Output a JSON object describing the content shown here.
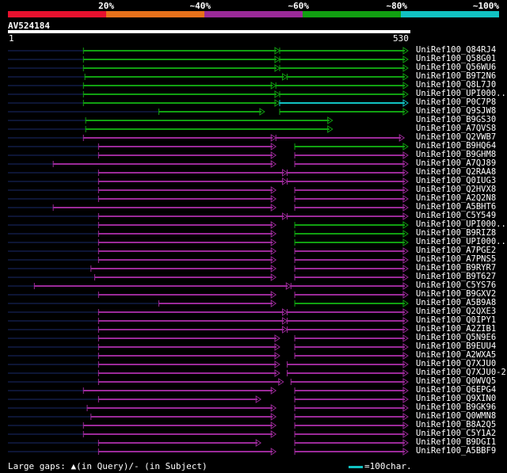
{
  "legend": {
    "labels": [
      "20%",
      "~40%",
      "~60%",
      "~80%",
      "~100%"
    ],
    "colors": [
      "#e8112e",
      "#e8711b",
      "#9b2a99",
      "#11a011",
      "#11c3c3"
    ]
  },
  "query": {
    "name": "AV524184",
    "start_label": "1",
    "end_label": "530"
  },
  "footer": {
    "gaps_text": "Large gaps: ▲(in Query)/- (in Subject)",
    "scale_text": "=100char."
  },
  "chart_data": {
    "type": "alignment",
    "query_length": 530,
    "hits": [
      {
        "name": "UniRef100_Q84RJ4",
        "segments": [
          [
            100,
            360,
            "green"
          ],
          [
            360,
            530,
            "green"
          ]
        ]
      },
      {
        "name": "UniRef100_Q58G01",
        "segments": [
          [
            100,
            360,
            "green"
          ],
          [
            360,
            530,
            "green"
          ]
        ]
      },
      {
        "name": "UniRef100_Q56WU6",
        "segments": [
          [
            100,
            360,
            "green"
          ],
          [
            360,
            530,
            "green"
          ]
        ]
      },
      {
        "name": "UniRef100_B9T2N6",
        "segments": [
          [
            102,
            370,
            "green"
          ],
          [
            370,
            530,
            "green"
          ]
        ]
      },
      {
        "name": "UniRef100_Q8L7J0",
        "segments": [
          [
            100,
            355,
            "green"
          ],
          [
            355,
            530,
            "green"
          ]
        ]
      },
      {
        "name": "UniRef100_UPI000..",
        "segments": [
          [
            100,
            360,
            "green"
          ],
          [
            360,
            530,
            "green"
          ]
        ]
      },
      {
        "name": "UniRef100_P0C7P8",
        "segments": [
          [
            100,
            360,
            "green"
          ],
          [
            360,
            530,
            "cyan"
          ]
        ]
      },
      {
        "name": "UniRef100_Q9SJW8",
        "segments": [
          [
            200,
            340,
            "green"
          ],
          [
            360,
            530,
            "green"
          ]
        ]
      },
      {
        "name": "UniRef100_B9GS30",
        "segments": [
          [
            103,
            430,
            "green"
          ]
        ]
      },
      {
        "name": "UniRef100_A7QVS8",
        "segments": [
          [
            103,
            430,
            "green"
          ]
        ]
      },
      {
        "name": "UniRef100_Q2VWB7",
        "segments": [
          [
            100,
            355,
            "purple"
          ],
          [
            355,
            525,
            "purple"
          ]
        ]
      },
      {
        "name": "UniRef100_B9HQ64",
        "segments": [
          [
            120,
            355,
            "purple"
          ],
          [
            380,
            530,
            "green"
          ]
        ]
      },
      {
        "name": "UniRef100_B9GHM8",
        "segments": [
          [
            120,
            355,
            "purple"
          ],
          [
            380,
            530,
            "purple"
          ]
        ]
      },
      {
        "name": "UniRef100_A7QJ89",
        "segments": [
          [
            60,
            355,
            "purple"
          ],
          [
            380,
            530,
            "purple"
          ]
        ]
      },
      {
        "name": "UniRef100_Q2RAA8",
        "segments": [
          [
            120,
            370,
            "purple"
          ],
          [
            370,
            530,
            "purple"
          ]
        ]
      },
      {
        "name": "UniRef100_Q0IUG3",
        "segments": [
          [
            120,
            370,
            "purple"
          ],
          [
            370,
            530,
            "purple"
          ]
        ]
      },
      {
        "name": "UniRef100_Q2HVX8",
        "segments": [
          [
            120,
            355,
            "purple"
          ],
          [
            380,
            530,
            "purple"
          ]
        ]
      },
      {
        "name": "UniRef100_A2Q2N8",
        "segments": [
          [
            120,
            355,
            "purple"
          ],
          [
            380,
            530,
            "purple"
          ]
        ]
      },
      {
        "name": "UniRef100_A5BHT6",
        "segments": [
          [
            60,
            355,
            "purple"
          ],
          [
            380,
            530,
            "purple"
          ]
        ]
      },
      {
        "name": "UniRef100_C5Y549",
        "segments": [
          [
            120,
            370,
            "purple"
          ],
          [
            370,
            530,
            "purple"
          ]
        ]
      },
      {
        "name": "UniRef100_UPI000..",
        "segments": [
          [
            120,
            355,
            "purple"
          ],
          [
            380,
            530,
            "green"
          ]
        ]
      },
      {
        "name": "UniRef100_B9RIZ8",
        "segments": [
          [
            120,
            355,
            "purple"
          ],
          [
            380,
            530,
            "green"
          ]
        ]
      },
      {
        "name": "UniRef100_UPI000..",
        "segments": [
          [
            120,
            355,
            "purple"
          ],
          [
            380,
            530,
            "green"
          ]
        ]
      },
      {
        "name": "UniRef100_A7PGE2",
        "segments": [
          [
            120,
            355,
            "purple"
          ],
          [
            380,
            530,
            "purple"
          ]
        ]
      },
      {
        "name": "UniRef100_A7PNS5",
        "segments": [
          [
            120,
            355,
            "purple"
          ],
          [
            380,
            530,
            "purple"
          ]
        ]
      },
      {
        "name": "UniRef100_B9RYR7",
        "segments": [
          [
            110,
            355,
            "purple"
          ],
          [
            380,
            530,
            "purple"
          ]
        ]
      },
      {
        "name": "UniRef100_B9T627",
        "segments": [
          [
            115,
            355,
            "purple"
          ],
          [
            380,
            530,
            "purple"
          ]
        ]
      },
      {
        "name": "UniRef100_C5YS76",
        "segments": [
          [
            35,
            375,
            "purple"
          ],
          [
            375,
            530,
            "purple"
          ]
        ]
      },
      {
        "name": "UniRef100_B9GXV2",
        "segments": [
          [
            120,
            355,
            "purple"
          ],
          [
            380,
            530,
            "purple"
          ]
        ]
      },
      {
        "name": "UniRef100_A5B9A8",
        "segments": [
          [
            200,
            355,
            "purple"
          ],
          [
            380,
            530,
            "green"
          ]
        ]
      },
      {
        "name": "UniRef100_Q2QXE3",
        "segments": [
          [
            120,
            370,
            "purple"
          ],
          [
            370,
            530,
            "purple"
          ]
        ]
      },
      {
        "name": "UniRef100_Q0IPY1",
        "segments": [
          [
            120,
            370,
            "purple"
          ],
          [
            370,
            530,
            "purple"
          ]
        ]
      },
      {
        "name": "UniRef100_A2ZIB1",
        "segments": [
          [
            120,
            370,
            "purple"
          ],
          [
            370,
            530,
            "purple"
          ]
        ]
      },
      {
        "name": "UniRef100_Q5N9E6",
        "segments": [
          [
            120,
            360,
            "purple"
          ],
          [
            380,
            530,
            "purple"
          ]
        ]
      },
      {
        "name": "UniRef100_B9EUU4",
        "segments": [
          [
            120,
            360,
            "purple"
          ],
          [
            380,
            530,
            "purple"
          ]
        ]
      },
      {
        "name": "UniRef100_A2WXA5",
        "segments": [
          [
            120,
            360,
            "purple"
          ],
          [
            380,
            530,
            "purple"
          ]
        ]
      },
      {
        "name": "UniRef100_Q7XJU0",
        "segments": [
          [
            120,
            360,
            "purple"
          ],
          [
            370,
            530,
            "purple"
          ]
        ]
      },
      {
        "name": "UniRef100_Q7XJU0-2",
        "segments": [
          [
            120,
            360,
            "purple"
          ],
          [
            370,
            530,
            "purple"
          ]
        ]
      },
      {
        "name": "UniRef100_Q0WVQ5",
        "segments": [
          [
            120,
            365,
            "purple"
          ],
          [
            375,
            530,
            "purple"
          ]
        ]
      },
      {
        "name": "UniRef100_Q6EPG4",
        "segments": [
          [
            100,
            355,
            "purple"
          ],
          [
            380,
            530,
            "purple"
          ]
        ]
      },
      {
        "name": "UniRef100_Q9XIN0",
        "segments": [
          [
            120,
            335,
            "purple"
          ],
          [
            380,
            530,
            "purple"
          ]
        ]
      },
      {
        "name": "UniRef100_B9GK96",
        "segments": [
          [
            105,
            355,
            "purple"
          ],
          [
            380,
            530,
            "purple"
          ]
        ]
      },
      {
        "name": "UniRef100_Q0WMN8",
        "segments": [
          [
            110,
            355,
            "purple"
          ],
          [
            380,
            530,
            "purple"
          ]
        ]
      },
      {
        "name": "UniRef100_B8A2Q5",
        "segments": [
          [
            100,
            355,
            "purple"
          ],
          [
            380,
            530,
            "purple"
          ]
        ]
      },
      {
        "name": "UniRef100_C5Y1A2",
        "segments": [
          [
            100,
            355,
            "purple"
          ],
          [
            380,
            530,
            "purple"
          ]
        ]
      },
      {
        "name": "UniRef100_B9DGI1",
        "segments": [
          [
            120,
            335,
            "purple"
          ],
          [
            380,
            530,
            "purple"
          ]
        ]
      },
      {
        "name": "UniRef100_A5BBF9",
        "segments": [
          [
            120,
            355,
            "purple"
          ],
          [
            380,
            530,
            "purple"
          ]
        ]
      }
    ]
  }
}
